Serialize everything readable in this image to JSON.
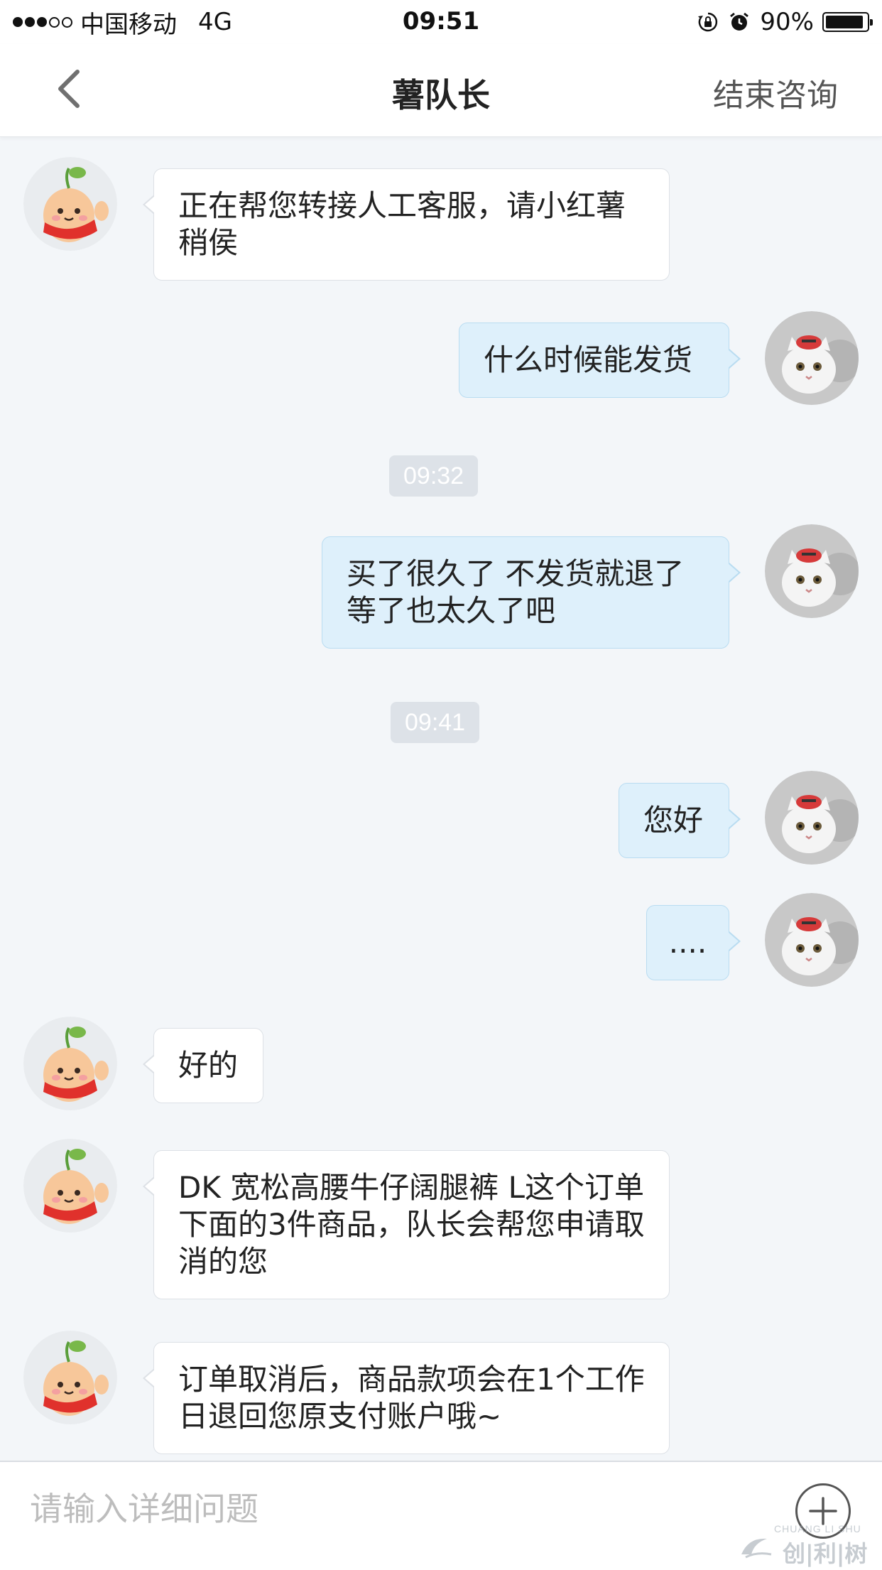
{
  "status_bar": {
    "carrier": "中国移动",
    "network": "4G",
    "time": "09:51",
    "battery": "90%"
  },
  "nav": {
    "title": "薯队长",
    "end_label": "结束咨询"
  },
  "messages": [
    {
      "sender": "agent",
      "text": "正在帮您转接人工客服，请小红薯稍侯"
    },
    {
      "sender": "user",
      "text": "什么时候能发货"
    },
    {
      "sender": "time",
      "text": "09:32"
    },
    {
      "sender": "user",
      "text": "买了很久了 不发货就退了等了也太久了吧"
    },
    {
      "sender": "time",
      "text": "09:41"
    },
    {
      "sender": "user",
      "text": "您好"
    },
    {
      "sender": "user",
      "text": "...."
    },
    {
      "sender": "agent",
      "text": "好的"
    },
    {
      "sender": "agent",
      "text": "DK 宽松高腰牛仔阔腿裤 L这个订单下面的3件商品，队长会帮您申请取消的您"
    },
    {
      "sender": "agent",
      "text": "订单取消后，商品款项会在1个工作日退回您原支付账户哦~"
    }
  ],
  "input": {
    "placeholder": "请输入详细问题"
  },
  "watermark": {
    "sub": "CHUANG LI SHU",
    "main": "创|利|树"
  },
  "colors": {
    "background": "#f3f6f9",
    "user_bubble": "#def0fb",
    "agent_bubble": "#ffffff",
    "time_pill": "#dde2e8"
  },
  "icons": [
    "back-chevron-icon",
    "plus-icon",
    "alarm-icon",
    "rotation-lock-icon",
    "battery-icon"
  ]
}
